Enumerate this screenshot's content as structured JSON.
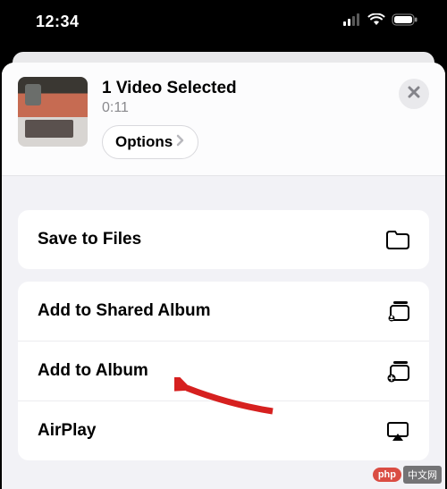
{
  "status": {
    "time": "12:34"
  },
  "header": {
    "title": "1 Video Selected",
    "duration": "0:11",
    "options_label": "Options"
  },
  "actions": {
    "save_to_files": "Save to Files",
    "add_to_shared_album": "Add to Shared Album",
    "add_to_album": "Add to Album",
    "airplay": "AirPlay"
  },
  "watermark": {
    "badge": "php",
    "text": "中文网"
  }
}
